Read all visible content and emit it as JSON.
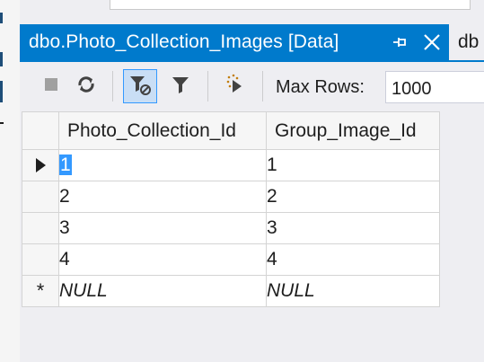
{
  "document_tab": {
    "title": "dbo.Photo_Collection_Images [Data]",
    "next_tab_title": "db"
  },
  "toolbar": {
    "max_rows_label": "Max Rows:",
    "max_rows_value": "1000",
    "buttons": [
      "stop-icon",
      "refresh-icon",
      "apply-filter-icon",
      "filter-icon",
      "select-top-rows-icon"
    ]
  },
  "grid": {
    "columns": [
      "Photo_Collection_Id",
      "Group_Image_Id"
    ],
    "rows": [
      {
        "cells": [
          "1",
          "1"
        ]
      },
      {
        "cells": [
          "2",
          "2"
        ]
      },
      {
        "cells": [
          "3",
          "3"
        ]
      },
      {
        "cells": [
          "4",
          "4"
        ]
      }
    ],
    "new_row": {
      "marker": "*",
      "cells": [
        "NULL",
        "NULL"
      ]
    }
  },
  "colors": {
    "accent": "#007acc",
    "selection": "#3399ff"
  }
}
